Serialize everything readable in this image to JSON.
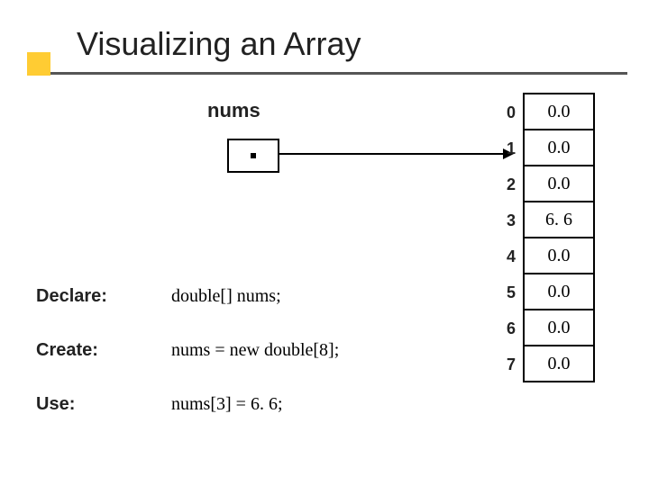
{
  "title": "Visualizing an Array",
  "pointer_label": "nums",
  "array": {
    "indices": [
      "0",
      "1",
      "2",
      "3",
      "4",
      "5",
      "6",
      "7"
    ],
    "values": [
      "0.0",
      "0.0",
      "0.0",
      "6. 6",
      "0.0",
      "0.0",
      "0.0",
      "0.0"
    ]
  },
  "rows": [
    {
      "label": "Declare:",
      "code": "double[] nums;"
    },
    {
      "label": "Create:",
      "code": "nums = new double[8];"
    },
    {
      "label": "Use:",
      "code": "nums[3] = 6. 6;"
    }
  ]
}
